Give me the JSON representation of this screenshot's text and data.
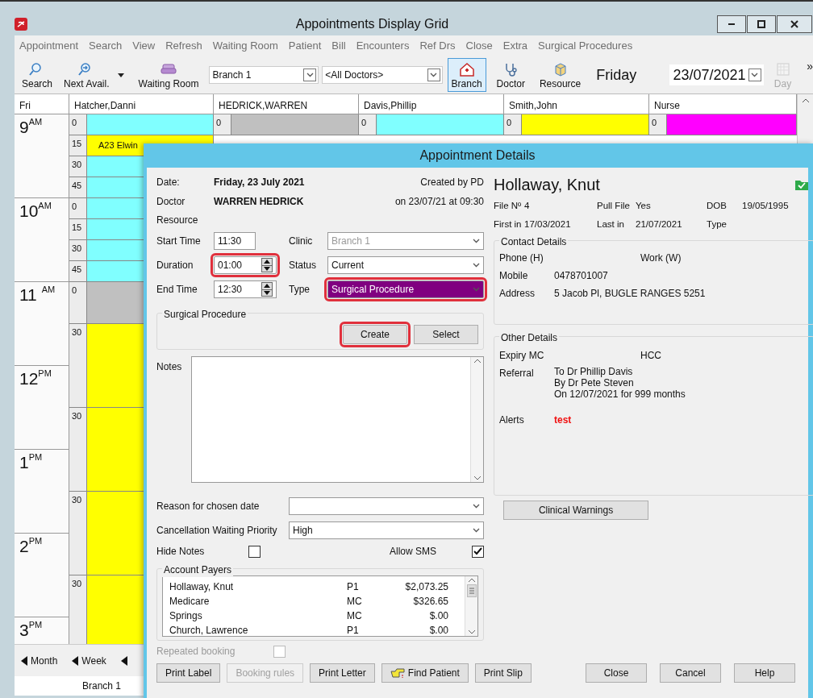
{
  "window": {
    "title": "Appointments Display Grid"
  },
  "menu": [
    "Appointment",
    "Search",
    "View",
    "Refresh",
    "Waiting Room",
    "Patient",
    "Bill",
    "Encounters",
    "Ref Drs",
    "Close",
    "Extra",
    "Surgical Procedures"
  ],
  "toolbar": {
    "tools": [
      {
        "label": "Search",
        "kind": "search"
      },
      {
        "label": "Next Avail.",
        "kind": "next"
      },
      {
        "label": "Waiting Room",
        "kind": "sofa"
      }
    ],
    "branch_select": "Branch 1",
    "doctor_select": "<All Doctors>",
    "views": [
      {
        "label": "Branch",
        "kind": "house",
        "selected": true
      },
      {
        "label": "Doctor",
        "kind": "stethoscope",
        "selected": false
      },
      {
        "label": "Resource",
        "kind": "cube",
        "selected": false
      }
    ],
    "day_name": "Friday",
    "date": "23/07/2021",
    "day_button": {
      "label": "Day",
      "disabled": true
    },
    "overflow": "»"
  },
  "grid": {
    "columns": [
      "Fri",
      "Hatcher,Danni",
      "HEDRICK,WARREN",
      "Davis,Phillip",
      "Smith,John",
      "Nurse"
    ],
    "hours": [
      "9$^{AM}$",
      "10$^{AM}$",
      "11 $^{AM}$",
      "12$^{PM}$",
      "1$^{PM}$",
      "2$^{PM}$",
      "3$^{PM}$"
    ],
    "slots": [
      {
        "minute": "0",
        "kind": "quarter",
        "color": "#80ffff"
      },
      {
        "minute": "15",
        "kind": "quarter",
        "color": "#ffff00",
        "appointment": "A23 Elwin"
      },
      {
        "minute": "30",
        "kind": "quarter",
        "color": "#80ffff"
      },
      {
        "minute": "45",
        "kind": "quarter",
        "color": "#80ffff"
      },
      {
        "minute": "0",
        "kind": "quarter",
        "color": "#80ffff"
      },
      {
        "minute": "15",
        "kind": "quarter",
        "color": "#80ffff"
      },
      {
        "minute": "30",
        "kind": "quarter",
        "color": "#80ffff"
      },
      {
        "minute": "45",
        "kind": "quarter",
        "color": "#80ffff"
      },
      {
        "minute": "0",
        "kind": "half",
        "color": "#c0c0c0"
      },
      {
        "minute": "30",
        "kind": "hour",
        "color": "#ffff00"
      },
      {
        "minute": "30",
        "kind": "hour",
        "color": "#ffff00"
      },
      {
        "minute": "30",
        "kind": "hour",
        "color": "#ffff00"
      },
      {
        "minute": "30",
        "kind": "hour",
        "color": "#ffff00"
      }
    ],
    "other_columns": [
      {
        "minute": "0",
        "color": "#c0c0c0"
      },
      {
        "minute": "0",
        "color": "#80ffff"
      },
      {
        "minute": "0",
        "color": "#ffff00"
      },
      {
        "minute": "0",
        "color": "#ff00ff"
      }
    ]
  },
  "nav": [
    "Month",
    "Week"
  ],
  "status_bar": {
    "branch": "Branch 1"
  },
  "dialog": {
    "title": "Appointment Details",
    "date_label": "Date:",
    "date": "Friday, 23 July 2021",
    "created_by": "Created by PD",
    "doctor_label": "Doctor",
    "doctor": "WARREN HEDRICK",
    "created_on": "on 23/07/21 at 09:30",
    "resource_label": "Resource",
    "start_label": "Start Time",
    "start": "11:30",
    "duration_label": "Duration",
    "duration": {
      "value": "01:00",
      "highlighted": true
    },
    "end_label": "End Time",
    "end": "12:30",
    "clinic_label": "Clinic",
    "clinic": {
      "value": "Branch 1",
      "disabled": true
    },
    "status_label": "Status",
    "status": "Current",
    "type_label": "Type",
    "type": {
      "value": "Surgical Procedure",
      "highlighted": true
    },
    "procedure_group": "Surgical Procedure",
    "procedure_buttons": [
      {
        "label": "Create",
        "highlighted": true
      },
      {
        "label": "Select",
        "highlighted": false
      }
    ],
    "notes_label": "Notes",
    "reason_label": "Reason for chosen date",
    "priority_label": "Cancellation Waiting Priority",
    "priority": "High",
    "hide_notes": {
      "label": "Hide Notes",
      "checked": false
    },
    "allow_sms": {
      "label": "Allow SMS",
      "checked": true
    },
    "payers_label": "Account Payers",
    "payers": [
      {
        "name": "Hollaway, Knut",
        "code": "P1",
        "amount": "$2,073.25"
      },
      {
        "name": "Medicare",
        "code": "MC",
        "amount": "$326.65"
      },
      {
        "name": "Springs",
        "code": "MC",
        "amount": "$.00"
      },
      {
        "name": "Church, Lawrence",
        "code": "P1",
        "amount": "$.00"
      }
    ],
    "repeated": {
      "label": "Repeated booking",
      "checked": false,
      "disabled": true
    },
    "buttons": [
      {
        "label": "Print Label",
        "disabled": false,
        "kind": "plain"
      },
      {
        "label": "Booking rules",
        "disabled": true,
        "kind": "plain"
      },
      {
        "label": "Print Letter",
        "disabled": false,
        "kind": "plain"
      },
      {
        "label": "Find Patient",
        "disabled": false,
        "kind": "find"
      },
      {
        "label": "Print Slip",
        "disabled": false,
        "kind": "plain"
      }
    ],
    "right_buttons": [
      "Close",
      "Cancel",
      "Help"
    ],
    "patient": {
      "name": "Hollaway, Knut",
      "facts": [
        [
          {
            "label": "File Nº",
            "value": "4"
          },
          {
            "label": "Pull File",
            "value": "Yes"
          },
          {
            "label": "DOB",
            "value": "19/05/1995"
          }
        ],
        [
          {
            "label": "First in",
            "value": "17/03/2021"
          },
          {
            "label": "Last in",
            "value": "21/07/2021"
          },
          {
            "label": "Type"
          }
        ]
      ]
    },
    "contact_label": "Contact Details",
    "phone_label": "Phone (H)",
    "work_label": "Work (W)",
    "mobile_label": "Mobile",
    "mobile": "0478701007",
    "address_label": "Address",
    "address": "5 Jacob Pl,  BUGLE RANGES 5251",
    "other_label": "Other Details",
    "expiry_label": "Expiry  MC",
    "hcc_label": "HCC",
    "referral_label": "Referral",
    "referral": [
      "To Dr Phillip Davis",
      "By Dr Pete Steven",
      "On 12/07/2021 for 999 months"
    ],
    "alerts_label": "Alerts",
    "alerts": "test",
    "warnings_button": "Clinical Warnings"
  }
}
